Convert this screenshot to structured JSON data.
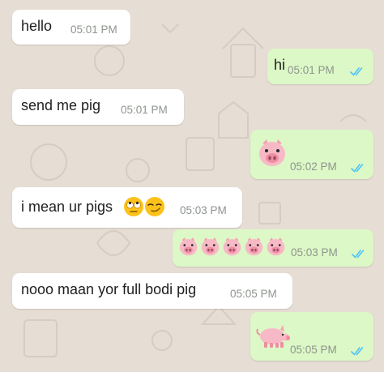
{
  "colors": {
    "wallpaper": "#e6ddd4",
    "incoming_bubble": "#ffffff",
    "outgoing_bubble": "#dcf8c6",
    "read_ticks": "#4fc3f7",
    "timestamp": "#8e948e"
  },
  "messages": [
    {
      "direction": "incoming",
      "text": "hello",
      "time": "05:01 PM"
    },
    {
      "direction": "outgoing",
      "text": "hi",
      "time": "05:01 PM",
      "status": "read"
    },
    {
      "direction": "incoming",
      "text": "send me pig",
      "time": "05:01 PM"
    },
    {
      "direction": "outgoing",
      "emoji": [
        "pig-face-icon"
      ],
      "time": "05:02 PM",
      "status": "read"
    },
    {
      "direction": "incoming",
      "text": "i mean ur pigs",
      "emoji": [
        "rolling-eyes-icon",
        "smirk-icon"
      ],
      "time": "05:03 PM"
    },
    {
      "direction": "outgoing",
      "emoji": [
        "pig-face-icon",
        "pig-face-icon",
        "pig-face-icon",
        "pig-face-icon",
        "pig-face-icon"
      ],
      "time": "05:03 PM",
      "status": "read"
    },
    {
      "direction": "incoming",
      "text": "nooo maan yor full bodi pig",
      "time": "05:05 PM"
    },
    {
      "direction": "outgoing",
      "emoji": [
        "pig-icon"
      ],
      "time": "05:05 PM",
      "status": "read"
    }
  ]
}
